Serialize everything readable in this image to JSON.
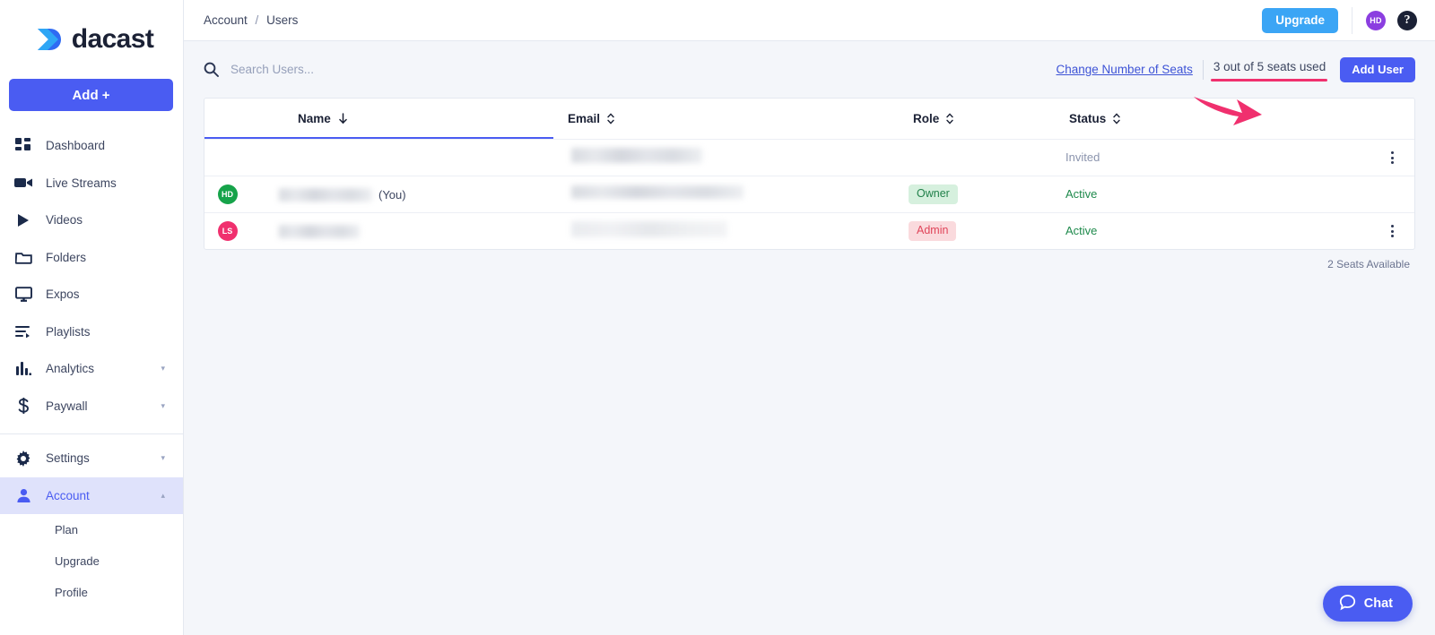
{
  "brand": {
    "name": "dacast",
    "logo_icon": "dacast-chevron-logo"
  },
  "sidebar": {
    "add_button": "Add +",
    "items": [
      {
        "label": "Dashboard",
        "icon": "dashboard-icon",
        "expandable": false,
        "active": false
      },
      {
        "label": "Live Streams",
        "icon": "video-camera-icon",
        "expandable": false,
        "active": false
      },
      {
        "label": "Videos",
        "icon": "play-icon",
        "expandable": false,
        "active": false
      },
      {
        "label": "Folders",
        "icon": "folder-icon",
        "expandable": false,
        "active": false
      },
      {
        "label": "Expos",
        "icon": "monitor-icon",
        "expandable": false,
        "active": false
      },
      {
        "label": "Playlists",
        "icon": "playlist-icon",
        "expandable": false,
        "active": false
      },
      {
        "label": "Analytics",
        "icon": "bar-chart-icon",
        "expandable": true,
        "active": false
      },
      {
        "label": "Paywall",
        "icon": "dollar-icon",
        "expandable": true,
        "active": false
      }
    ],
    "lower_items": [
      {
        "label": "Settings",
        "icon": "gear-icon",
        "expandable": true,
        "active": false
      },
      {
        "label": "Account",
        "icon": "person-icon",
        "expandable": true,
        "active": true
      }
    ],
    "sub_items": [
      {
        "label": "Plan"
      },
      {
        "label": "Upgrade"
      },
      {
        "label": "Profile"
      }
    ]
  },
  "topbar": {
    "breadcrumb": {
      "parent": "Account",
      "separator": "/",
      "current": "Users"
    },
    "upgrade_label": "Upgrade",
    "avatar_initials": "HD",
    "avatar_color": "#8b3ee0",
    "help_glyph": "?"
  },
  "toolbar": {
    "search_placeholder": "Search Users...",
    "search_value": "",
    "change_seats_label": "Change Number of Seats",
    "seats_used_text": "3 out of 5 seats used",
    "add_user_label": "Add User",
    "annotation_color": "#f0306e"
  },
  "table": {
    "columns": [
      {
        "label": "Name",
        "sort": "desc"
      },
      {
        "label": "Email",
        "sort": "none"
      },
      {
        "label": "Role",
        "sort": "none"
      },
      {
        "label": "Status",
        "sort": "none"
      }
    ],
    "rows": [
      {
        "avatar": null,
        "avatar_color": null,
        "name_redacted": false,
        "name_suffix": "",
        "email_redacted": true,
        "role": "",
        "role_style": "none",
        "status": "Invited",
        "status_style": "invited",
        "has_menu": true
      },
      {
        "avatar": "HD",
        "avatar_color": "#16a34a",
        "name_redacted": true,
        "name_suffix": "(You)",
        "email_redacted": true,
        "role": "Owner",
        "role_style": "owner",
        "status": "Active",
        "status_style": "active",
        "has_menu": false
      },
      {
        "avatar": "LS",
        "avatar_color": "#f0306e",
        "name_redacted": true,
        "name_suffix": "",
        "email_redacted": true,
        "role": "Admin",
        "role_style": "admin",
        "status": "Active",
        "status_style": "active",
        "has_menu": true
      }
    ],
    "footer_text": "2 Seats Available"
  },
  "chat": {
    "label": "Chat",
    "icon": "chat-bubble-icon"
  },
  "colors": {
    "primary": "#4a5cf2",
    "upgrade_blue": "#3ba5f5",
    "accent_pink": "#f0306e",
    "green": "#1f8a4c",
    "page_bg": "#f4f6fa"
  }
}
